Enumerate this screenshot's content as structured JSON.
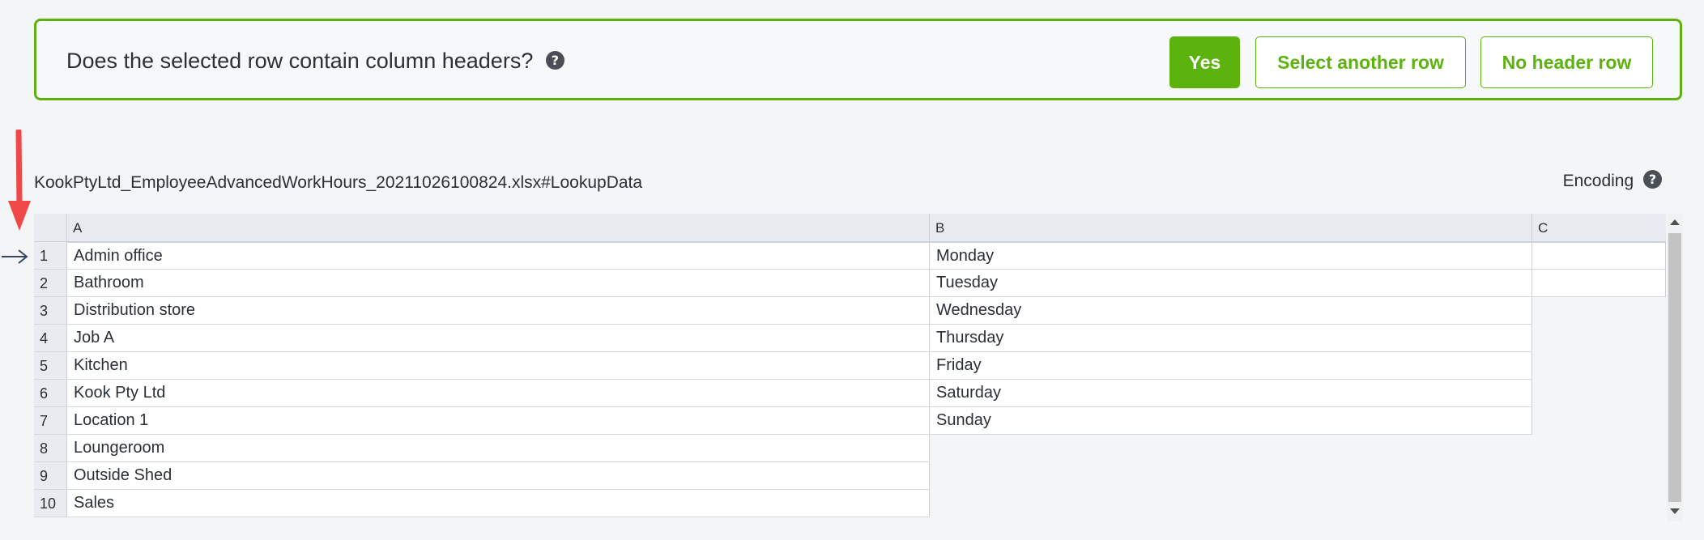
{
  "prompt": {
    "question": "Does the selected row contain column headers?",
    "help_icon": "?",
    "buttons": {
      "yes": "Yes",
      "select_another": "Select another row",
      "no_header": "No header row"
    },
    "accent_color": "#5db30e"
  },
  "file": {
    "name": "KookPtyLtd_EmployeeAdvancedWorkHours_20211026100824.xlsx#LookupData",
    "encoding_label": "Encoding",
    "encoding_help_icon": "?"
  },
  "grid": {
    "columns": [
      "A",
      "B",
      "C"
    ],
    "selected_row": 1,
    "rows": [
      {
        "num": "1",
        "cells": [
          "Admin office",
          "Monday",
          ""
        ]
      },
      {
        "num": "2",
        "cells": [
          "Bathroom",
          "Tuesday",
          ""
        ]
      },
      {
        "num": "3",
        "cells": [
          "Distribution store",
          "Wednesday"
        ]
      },
      {
        "num": "4",
        "cells": [
          "Job A",
          "Thursday"
        ]
      },
      {
        "num": "5",
        "cells": [
          "Kitchen",
          "Friday"
        ]
      },
      {
        "num": "6",
        "cells": [
          "Kook Pty Ltd",
          "Saturday"
        ]
      },
      {
        "num": "7",
        "cells": [
          "Location 1",
          "Sunday"
        ]
      },
      {
        "num": "8",
        "cells": [
          "Loungeroom"
        ]
      },
      {
        "num": "9",
        "cells": [
          "Outside Shed"
        ]
      },
      {
        "num": "10",
        "cells": [
          "Sales"
        ]
      }
    ]
  },
  "icons": {
    "red_arrow": "arrow-down-icon",
    "row_pointer": "arrow-right-icon"
  }
}
